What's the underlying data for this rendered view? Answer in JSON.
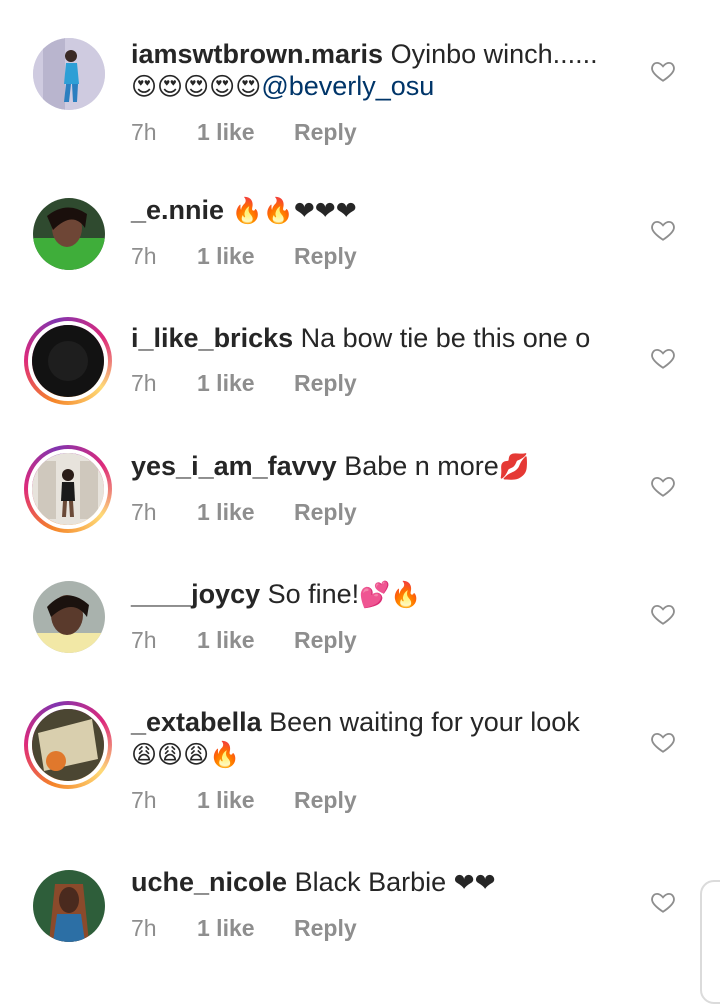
{
  "comments": [
    {
      "username": "iamswtbrown.maris",
      "text": "Oyinbo winch......",
      "emoji": "😍😍😍😍😍",
      "mention": "@beverly_osu",
      "time": "7h",
      "likes": "1 like",
      "reply": "Reply",
      "story": false
    },
    {
      "username": "_e.nnie",
      "text": "",
      "emoji": "🔥🔥❤❤❤",
      "time": "7h",
      "likes": "1 like",
      "reply": "Reply",
      "story": false
    },
    {
      "username": "i_like_bricks",
      "text": "Na bow tie be this one o",
      "emoji": "",
      "time": "7h",
      "likes": "1 like",
      "reply": "Reply",
      "story": true
    },
    {
      "username": "yes_i_am_favvy",
      "text": "Babe n more",
      "emoji": "💋",
      "time": "7h",
      "likes": "1 like",
      "reply": "Reply",
      "story": true
    },
    {
      "username": "____joycy",
      "text": "So fine!",
      "emoji": "💕🔥",
      "time": "7h",
      "likes": "1 like",
      "reply": "Reply",
      "story": false
    },
    {
      "username": "_extabella",
      "text": "Been waiting for your look",
      "emoji": "😩😩😩🔥",
      "time": "7h",
      "likes": "1 like",
      "reply": "Reply",
      "story": true
    },
    {
      "username": "uche_nicole",
      "text": "Black Barbie",
      "emoji": "❤❤",
      "time": "7h",
      "likes": "1 like",
      "reply": "Reply",
      "story": false
    }
  ],
  "colors": {
    "username": "#262626",
    "meta": "#8e8e8e",
    "mention": "#003569",
    "story_ring": "#dd2a7b"
  }
}
